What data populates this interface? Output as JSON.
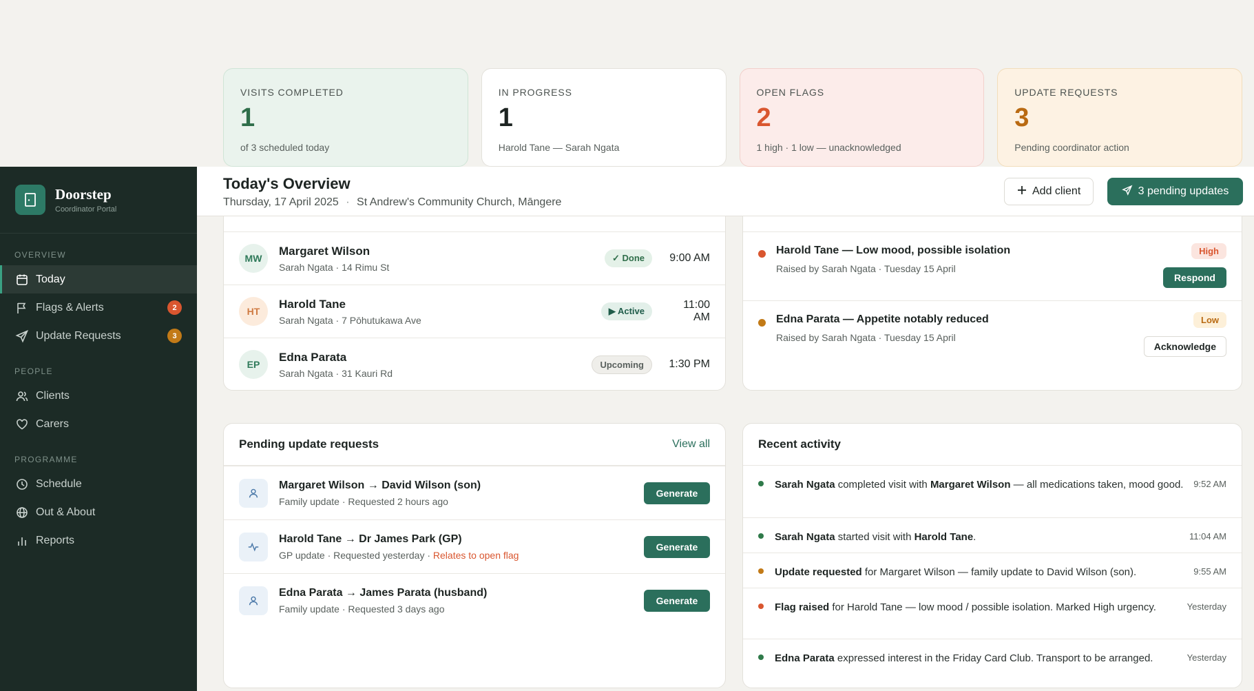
{
  "stats": [
    {
      "label": "VISITS COMPLETED",
      "value": "1",
      "sub": "of 3 scheduled today"
    },
    {
      "label": "IN PROGRESS",
      "value": "1",
      "sub": "Harold Tane — Sarah Ngata"
    },
    {
      "label": "OPEN FLAGS",
      "value": "2",
      "sub": "1 high · 1 low — unacknowledged"
    },
    {
      "label": "UPDATE REQUESTS",
      "value": "3",
      "sub": "Pending coordinator action"
    }
  ],
  "brand": {
    "name": "Doorstep",
    "sub": "Coordinator Portal"
  },
  "nav": {
    "sections": {
      "overview": "OVERVIEW",
      "people": "PEOPLE",
      "programme": "PROGRAMME"
    },
    "today": "Today",
    "flags": "Flags & Alerts",
    "flags_badge": "2",
    "requests": "Update Requests",
    "requests_badge": "3",
    "clients": "Clients",
    "carers": "Carers",
    "schedule": "Schedule",
    "out_about": "Out & About",
    "reports": "Reports"
  },
  "header": {
    "title": "Today's Overview",
    "date": "Thursday, 17 April 2025",
    "separator": "·",
    "location": "St Andrew's Community Church, Māngere",
    "add_client": "Add client",
    "pending_updates": "3 pending updates"
  },
  "visits": [
    {
      "initials": "MW",
      "name": "Margaret Wilson",
      "carer": "Sarah Ngata",
      "address": "14 Rimu St",
      "status": "✓ Done",
      "time": "9:00 AM"
    },
    {
      "initials": "HT",
      "name": "Harold Tane",
      "carer": "Sarah Ngata",
      "address": "7 Pōhutukawa Ave",
      "status": "▶ Active",
      "time": "11:00 AM"
    },
    {
      "initials": "EP",
      "name": "Edna Parata",
      "carer": "Sarah Ngata",
      "address": "31 Kauri Rd",
      "status": "Upcoming",
      "time": "1:30 PM"
    }
  ],
  "flags": [
    {
      "title": "Harold Tane — Low mood, possible isolation",
      "raised_by": "Raised by Sarah Ngata",
      "date": "Tuesday 15 April",
      "level": "High",
      "action": "Respond",
      "color": "#d9562f"
    },
    {
      "title": "Edna Parata — Appetite notably reduced",
      "raised_by": "Raised by Sarah Ngata",
      "date": "Tuesday 15 April",
      "level": "Low",
      "action": "Acknowledge",
      "color": "#c27a17"
    }
  ],
  "requests_panel": {
    "title": "Pending update requests",
    "view_all": "View all",
    "items": [
      {
        "title": "Margaret Wilson → David Wilson (son)",
        "type": "Family update",
        "when": "Requested 2 hours ago",
        "flag_note": "",
        "action": "Generate"
      },
      {
        "title": "Harold Tane → Dr James Park (GP)",
        "type": "GP update",
        "when": "Requested yesterday",
        "flag_note": "Relates to open flag",
        "action": "Generate"
      },
      {
        "title": "Edna Parata → James Parata (husband)",
        "type": "Family update",
        "when": "Requested 3 days ago",
        "flag_note": "",
        "action": "Generate"
      }
    ]
  },
  "activity_panel": {
    "title": "Recent activity",
    "items": [
      {
        "strong1": "Sarah Ngata",
        "text1": " completed visit with ",
        "strong2": "Margaret Wilson",
        "text2": " — all medications taken, mood good.",
        "time": "9:52 AM",
        "color": "#2f7a4a"
      },
      {
        "strong1": "Sarah Ngata",
        "text1": " started visit with ",
        "strong2": "Harold Tane",
        "text2": ".",
        "time": "11:04 AM",
        "color": "#2f7a4a"
      },
      {
        "strong1": "Update requested",
        "text1": " for Margaret Wilson — family update to David Wilson (son).",
        "strong2": "",
        "text2": "",
        "time": "9:55 AM",
        "color": "#c27a17"
      },
      {
        "strong1": "Flag raised",
        "text1": " for Harold Tane — low mood / possible isolation. Marked High urgency.",
        "strong2": "",
        "text2": "",
        "time": "Yesterday",
        "color": "#d9562f"
      },
      {
        "strong1": "Edna Parata",
        "text1": " expressed interest in the Friday Card Club. Transport to be arranged.",
        "strong2": "",
        "text2": "",
        "time": "Yesterday",
        "color": "#2f7a4a"
      }
    ]
  }
}
